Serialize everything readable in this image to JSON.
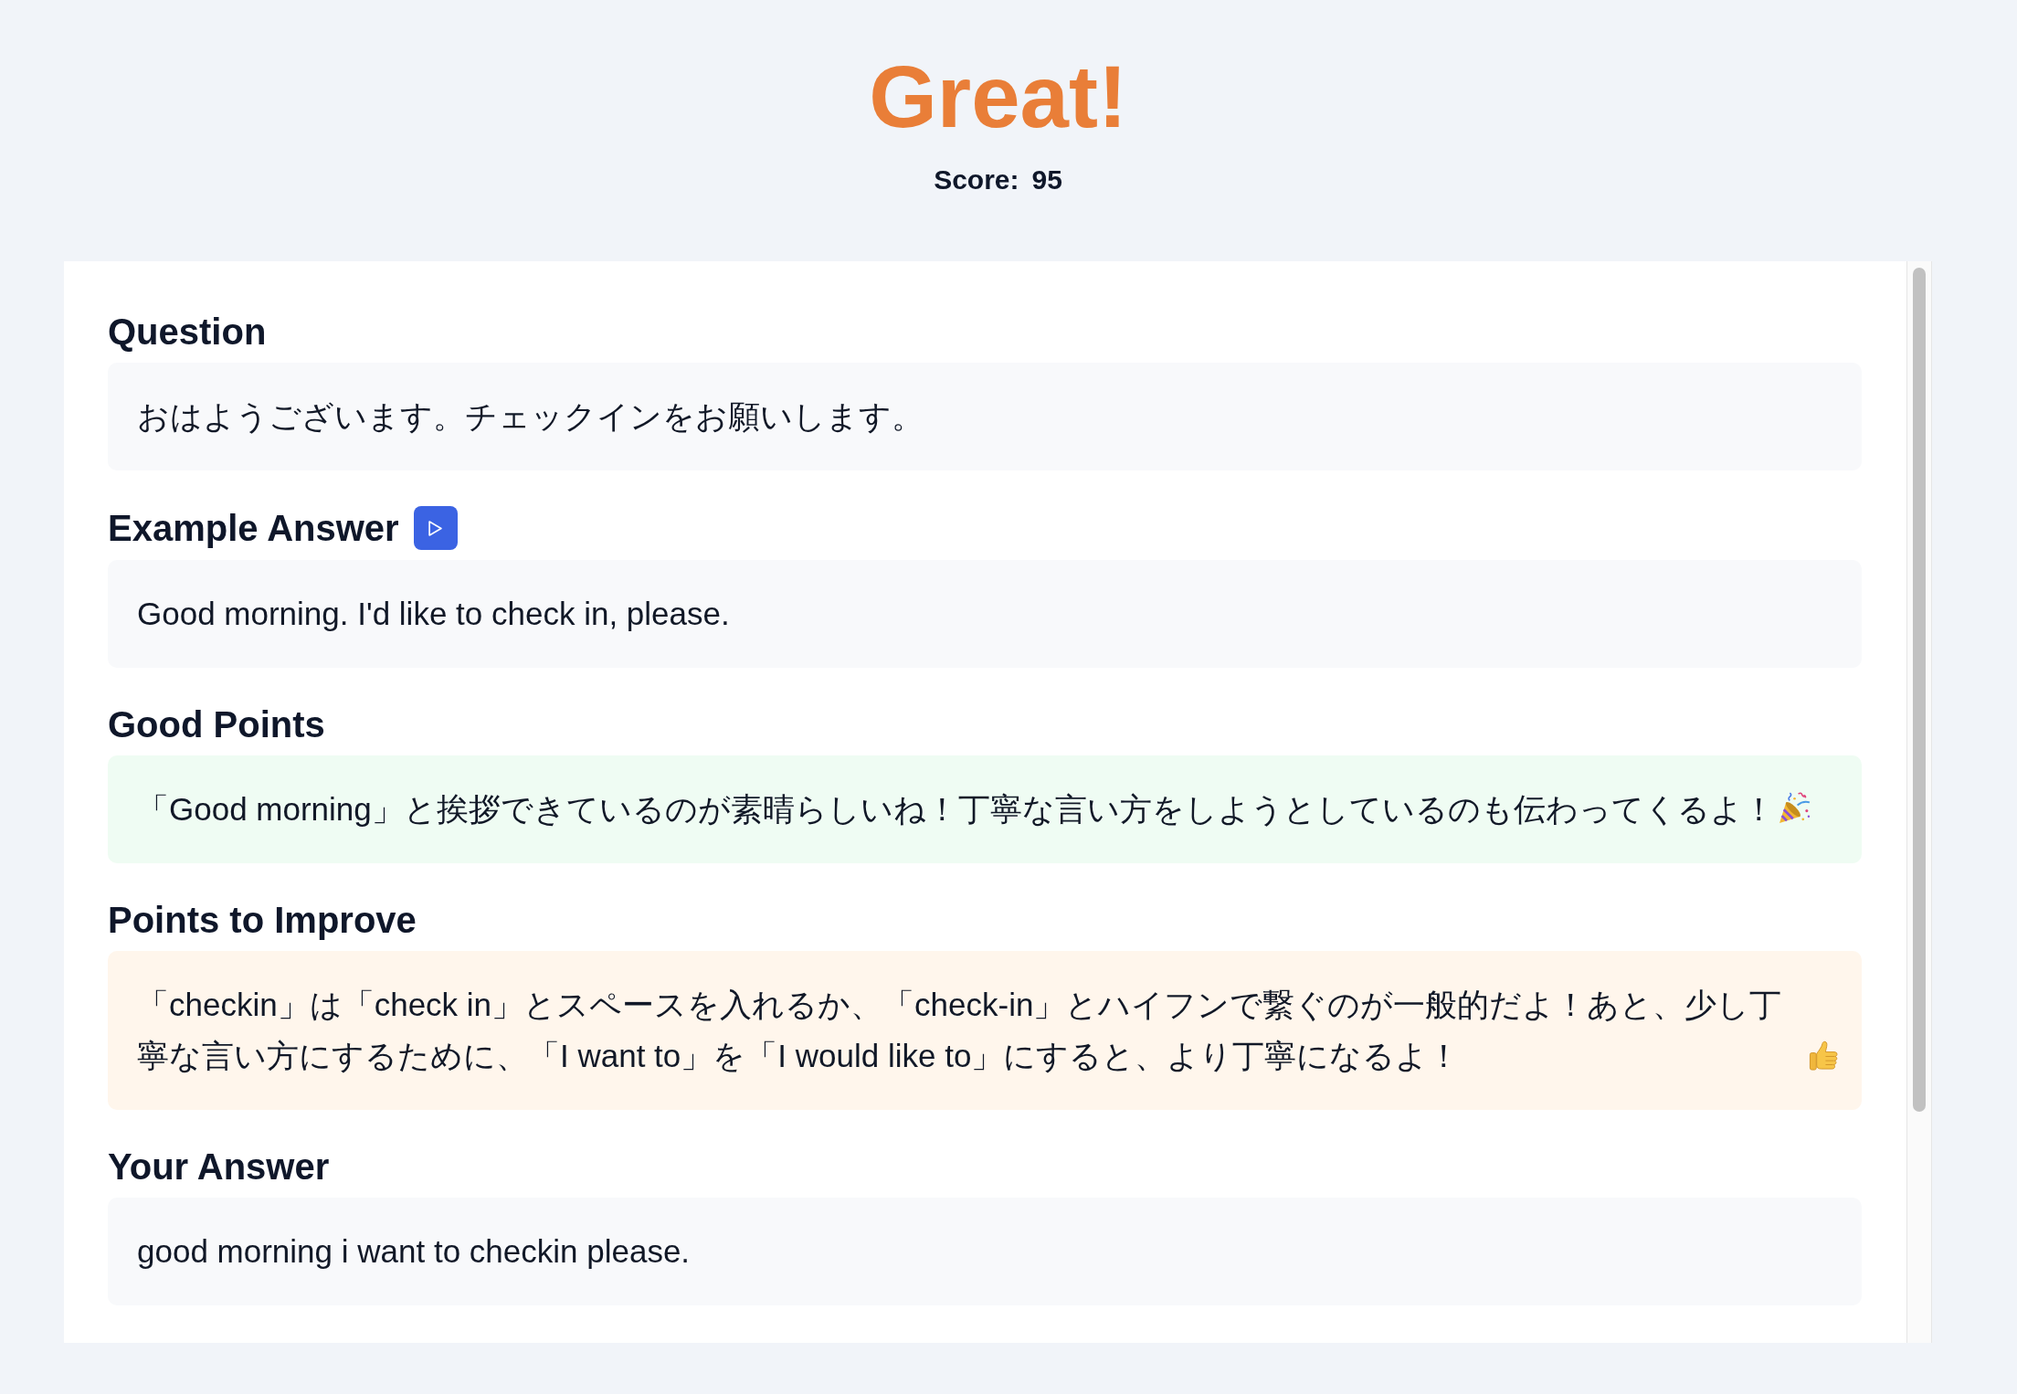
{
  "header": {
    "title": "Great!",
    "score": {
      "label": "Score:",
      "value": "95"
    }
  },
  "sections": [
    {
      "kind": "plain",
      "heading": "Question",
      "text": "おはようございます。チェックインをお願いします。"
    },
    {
      "kind": "audio",
      "heading": "Example Answer",
      "text": "Good morning. I'd like to check in, please."
    },
    {
      "kind": "good",
      "heading": "Good Points",
      "text": "「Good morning」と挨拶できているのが素晴らしいね！丁寧な言い方をしようとしているのも伝わってくるよ！"
    },
    {
      "kind": "improve",
      "heading": "Points to Improve",
      "text": "「checkin」は「check in」とスペースを入れるか、「check-in」とハイフンで繋ぐのが一般的だよ！あと、少し丁寧な言い方にするために、「I want to」を「I would like to」にすると、より丁寧になるよ！"
    },
    {
      "kind": "plain",
      "heading": "Your Answer",
      "text": "good morning i want to checkin please."
    }
  ]
}
